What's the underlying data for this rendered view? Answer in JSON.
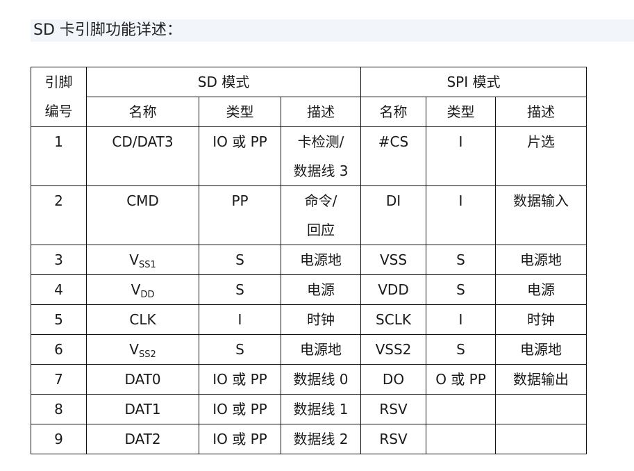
{
  "heading": "SD 卡引脚功能详述：",
  "table": {
    "pin_header": [
      "引脚",
      "编号"
    ],
    "sd_mode": "SD 模式",
    "spi_mode": "SPI 模式",
    "columns": {
      "sd_name": "名称",
      "sd_type": "类型",
      "sd_desc": "描述",
      "spi_name": "名称",
      "spi_type": "类型",
      "spi_desc": "描述"
    },
    "rows": [
      {
        "pin": "1",
        "sd_name": "CD/DAT3",
        "sd_type": "IO 或 PP",
        "sd_desc_1": "卡检测/",
        "sd_desc_2": "数据线 3",
        "spi_name": "#CS",
        "spi_type": "I",
        "spi_desc": "片选"
      },
      {
        "pin": "2",
        "sd_name": "CMD",
        "sd_type": "PP",
        "sd_desc_1": "命令/",
        "sd_desc_2": "回应",
        "spi_name": "DI",
        "spi_type": "I",
        "spi_desc": "数据输入"
      },
      {
        "pin": "3",
        "sd_name_main": "V",
        "sd_name_sub": "SS1",
        "sd_type": "S",
        "sd_desc": "电源地",
        "spi_name": "VSS",
        "spi_type": "S",
        "spi_desc": "电源地"
      },
      {
        "pin": "4",
        "sd_name_main": "V",
        "sd_name_sub": "DD",
        "sd_type": "S",
        "sd_desc": "电源",
        "spi_name": "VDD",
        "spi_type": "S",
        "spi_desc": "电源"
      },
      {
        "pin": "5",
        "sd_name": "CLK",
        "sd_type": "I",
        "sd_desc": "时钟",
        "spi_name": "SCLK",
        "spi_type": "I",
        "spi_desc": "时钟"
      },
      {
        "pin": "6",
        "sd_name_main": "V",
        "sd_name_sub": "SS2",
        "sd_type": "S",
        "sd_desc": "电源地",
        "spi_name": "VSS2",
        "spi_type": "S",
        "spi_desc": "电源地"
      },
      {
        "pin": "7",
        "sd_name": "DAT0",
        "sd_type": "IO 或 PP",
        "sd_desc": "数据线 0",
        "spi_name": "DO",
        "spi_type": "O 或 PP",
        "spi_desc": "数据输出"
      },
      {
        "pin": "8",
        "sd_name": "DAT1",
        "sd_type": "IO 或 PP",
        "sd_desc": "数据线 1",
        "spi_name": "RSV",
        "spi_type": "",
        "spi_desc": ""
      },
      {
        "pin": "9",
        "sd_name": "DAT2",
        "sd_type": "IO 或 PP",
        "sd_desc": "数据线 2",
        "spi_name": "RSV",
        "spi_type": "",
        "spi_desc": ""
      }
    ]
  }
}
